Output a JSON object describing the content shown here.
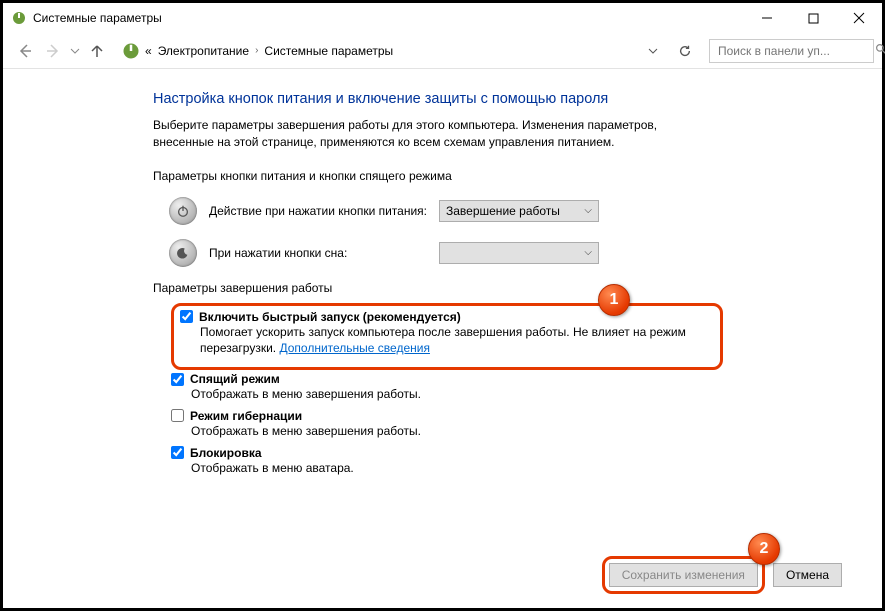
{
  "window": {
    "title": "Системные параметры"
  },
  "breadcrumb": {
    "prefix": "«",
    "item1": "Электропитание",
    "item2": "Системные параметры"
  },
  "search": {
    "placeholder": "Поиск в панели уп..."
  },
  "heading": "Настройка кнопок питания и включение защиты с помощью пароля",
  "description": "Выберите параметры завершения работы для этого компьютера. Изменения параметров, внесенные на этой странице, применяются ко всем схемам управления питанием.",
  "section_buttons": "Параметры кнопки питания и кнопки спящего режима",
  "power_row": {
    "label": "Действие при нажатии кнопки питания:",
    "value": "Завершение работы"
  },
  "sleep_row": {
    "label": "При нажатии кнопки сна:",
    "value": ""
  },
  "section_shutdown": "Параметры завершения работы",
  "checks": {
    "fast": {
      "label": "Включить быстрый запуск (рекомендуется)",
      "desc_a": "Помогает ускорить запуск компьютера после завершения работы. Не влияет на режим перезагрузки. ",
      "link": "Дополнительные сведения"
    },
    "sleep": {
      "label": "Спящий режим",
      "desc": "Отображать в меню завершения работы."
    },
    "hiber": {
      "label": "Режим гибернации",
      "desc": "Отображать в меню завершения работы."
    },
    "lock": {
      "label": "Блокировка",
      "desc": "Отображать в меню аватара."
    }
  },
  "buttons": {
    "save": "Сохранить изменения",
    "cancel": "Отмена"
  },
  "badges": {
    "b1": "1",
    "b2": "2"
  }
}
